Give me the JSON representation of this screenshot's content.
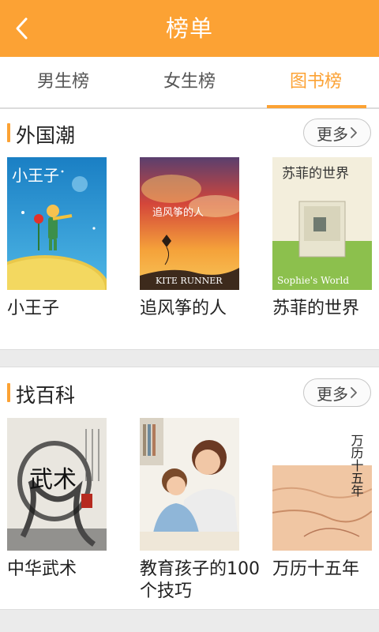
{
  "header": {
    "title": "榜单",
    "back_icon": "chevron-left-icon"
  },
  "tabs": [
    {
      "label": "男生榜",
      "active": false
    },
    {
      "label": "女生榜",
      "active": false
    },
    {
      "label": "图书榜",
      "active": true
    }
  ],
  "colors": {
    "accent": "#fca234",
    "background": "#ebebeb"
  },
  "sections": [
    {
      "title": "外国潮",
      "more_label": "更多",
      "books": [
        {
          "title": "小王子",
          "cover_text": "小王子"
        },
        {
          "title": "追风筝的人",
          "cover_text": "追风筝的人",
          "cover_subtext": "KITE RUNNER"
        },
        {
          "title": "苏菲的世界",
          "cover_text": "苏菲的世界",
          "cover_subtext": "Sophie's World"
        }
      ]
    },
    {
      "title": "找百科",
      "more_label": "更多",
      "books": [
        {
          "title": "中华武术",
          "cover_text": "武术"
        },
        {
          "title": "教育孩子的100个技巧"
        },
        {
          "title": "万历十五年",
          "cover_text": "万历十五年"
        }
      ]
    }
  ]
}
